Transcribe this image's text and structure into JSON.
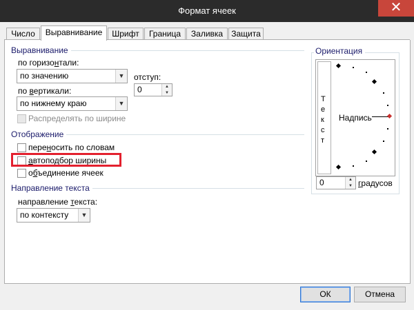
{
  "window": {
    "title": "Формат ячеек",
    "close_glyph": "✕"
  },
  "tabs": [
    {
      "label": "Число",
      "active": false
    },
    {
      "label": "Выравнивание",
      "active": true
    },
    {
      "label": "Шрифт",
      "active": false
    },
    {
      "label": "Граница",
      "active": false
    },
    {
      "label": "Заливка",
      "active": false
    },
    {
      "label": "Защита",
      "active": false
    }
  ],
  "alignment": {
    "group_title": "Выравнивание",
    "horizontal_label_pre": "по горизо",
    "horizontal_label_key": "н",
    "horizontal_label_post": "тали:",
    "horizontal_value": "по значению",
    "indent_label": "отступ:",
    "indent_value": "0",
    "vertical_label_pre": "по ",
    "vertical_label_key": "в",
    "vertical_label_post": "ертикали:",
    "vertical_value": "по нижнему краю",
    "distribute_label": "Распределять по ширине",
    "distribute_checked": false
  },
  "display": {
    "group_title": "Отображение",
    "wrap_pre": "пере",
    "wrap_key": "н",
    "wrap_post": "осить по словам",
    "wrap_checked": false,
    "shrink_key": "а",
    "shrink_post": "втоподбор ширины",
    "shrink_checked": false,
    "merge_pre": "о",
    "merge_key": "б",
    "merge_post": "ъединение ячеек",
    "merge_checked": false
  },
  "direction": {
    "group_title": "Направление текста",
    "label_pre": "направление ",
    "label_key": "т",
    "label_post": "екста:",
    "value": "по контексту"
  },
  "orientation": {
    "group_title": "Ориентация",
    "vertical_text": [
      "Т",
      "е",
      "к",
      "с",
      "т"
    ],
    "caption": "Надпись",
    "degrees_value": "0",
    "degrees_key": "г",
    "degrees_post": "радусов"
  },
  "buttons": {
    "ok": "ОК",
    "cancel": "Отмена"
  },
  "icons": {
    "combo_arrow": "chevron-down-icon",
    "spin": "spin-updown-icon"
  },
  "colors": {
    "titlebar": "#2b2b2b",
    "close": "#c8463b",
    "highlight": "#e3202e",
    "group_title": "#1a1a6a"
  }
}
